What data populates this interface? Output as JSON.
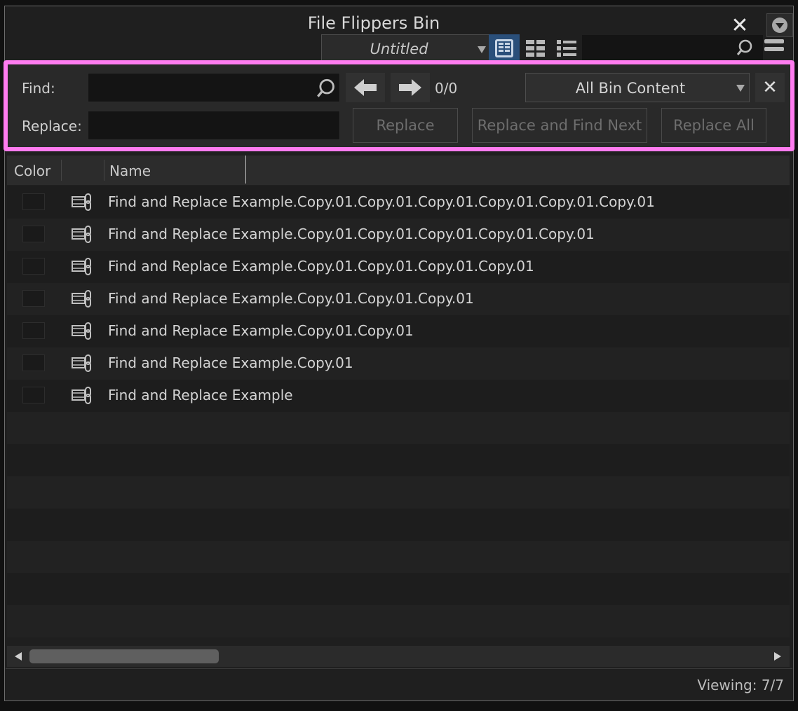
{
  "window": {
    "title": "File Flippers Bin"
  },
  "toolbar": {
    "view_name": "Untitled",
    "view_buttons": [
      "frame-view-icon",
      "grid-view-icon",
      "list-view-icon"
    ],
    "search_value": "",
    "accent_color": "#2a4f7a"
  },
  "find_panel": {
    "find_label": "Find:",
    "find_value": "",
    "replace_label": "Replace:",
    "replace_value": "",
    "match_count": "0/0",
    "scope": "All Bin Content",
    "replace_button": "Replace",
    "replace_find_next_button": "Replace and Find Next",
    "replace_all_button": "Replace All",
    "highlight_color": "#ff7cf0"
  },
  "columns": {
    "color": "Color",
    "name": "Name"
  },
  "rows": [
    {
      "name": "Find and Replace Example.Copy.01.Copy.01.Copy.01.Copy.01.Copy.01.Copy.01"
    },
    {
      "name": "Find and Replace Example.Copy.01.Copy.01.Copy.01.Copy.01.Copy.01"
    },
    {
      "name": "Find and Replace Example.Copy.01.Copy.01.Copy.01.Copy.01"
    },
    {
      "name": "Find and Replace Example.Copy.01.Copy.01.Copy.01"
    },
    {
      "name": "Find and Replace Example.Copy.01.Copy.01"
    },
    {
      "name": "Find and Replace Example.Copy.01"
    },
    {
      "name": "Find and Replace Example"
    }
  ],
  "status": {
    "viewing": "Viewing: 7/7"
  }
}
